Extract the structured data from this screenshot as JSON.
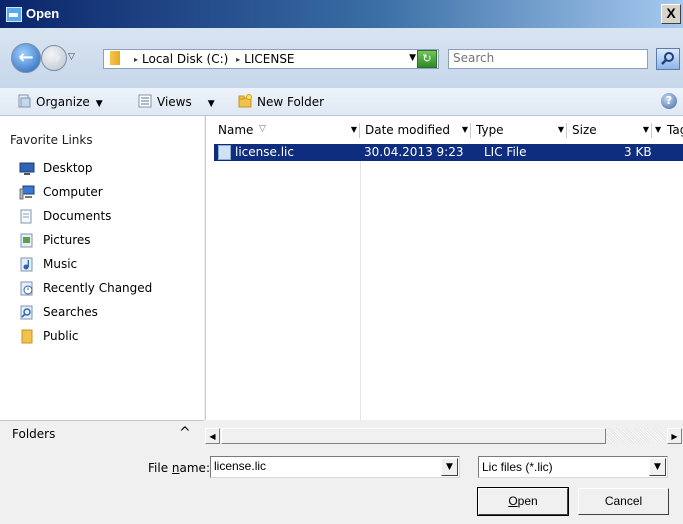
{
  "window": {
    "title": "Open",
    "close_glyph": "X"
  },
  "nav": {
    "back_glyph": "←",
    "forward_glyph": "→",
    "history_glyph": "▽",
    "breadcrumb": [
      "Local Disk (C:)",
      "LICENSE"
    ],
    "breadcrumb_arrow": "▸",
    "dropdown_glyph": "▼",
    "refresh_glyph": "↻",
    "search_placeholder": "Search"
  },
  "toolbar": {
    "organize": "Organize",
    "views": "Views",
    "new_folder": "New Folder",
    "dropdown_glyph": "▼",
    "help_glyph": "?"
  },
  "sidebar": {
    "heading": "Favorite Links",
    "items": [
      {
        "label": "Desktop",
        "icon": "desktop-icon"
      },
      {
        "label": "Computer",
        "icon": "computer-icon"
      },
      {
        "label": "Documents",
        "icon": "documents-icon"
      },
      {
        "label": "Pictures",
        "icon": "pictures-icon"
      },
      {
        "label": "Music",
        "icon": "music-icon"
      },
      {
        "label": "Recently Changed",
        "icon": "recent-icon"
      },
      {
        "label": "Searches",
        "icon": "searches-icon"
      },
      {
        "label": "Public",
        "icon": "folder-icon"
      }
    ],
    "folders_label": "Folders",
    "folders_toggle": "^"
  },
  "filelist": {
    "columns": [
      "Name",
      "Date modified",
      "Type",
      "Size",
      "Tags"
    ],
    "sort_glyph": "▽",
    "dropdown_glyph": "▼",
    "files": [
      {
        "name": "license.lic",
        "modified": "30.04.2013 9:23",
        "type": "LIC File",
        "size": "3 KB"
      }
    ]
  },
  "scroll": {
    "left_glyph": "◀",
    "right_glyph": "▶"
  },
  "footer": {
    "filename_label": "File name:",
    "filename_value": "license.lic",
    "filetype_value": "Lic files (*.lic)",
    "combo_glyph": "▼",
    "open": "Open",
    "cancel": "Cancel"
  },
  "colors": {
    "selection": "#0f2d7f",
    "titlebar_start": "#0a246a",
    "titlebar_end": "#a6caf0"
  }
}
